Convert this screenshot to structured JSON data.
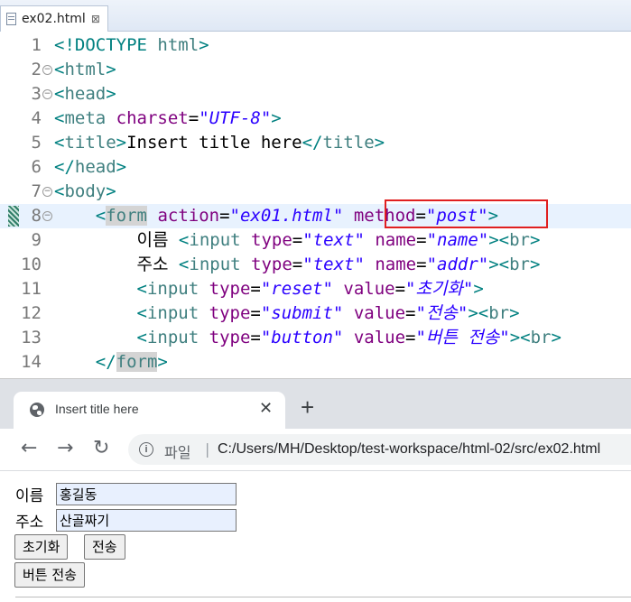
{
  "editor": {
    "tab_label": "ex02.html",
    "tab_close": "⊠",
    "lines": [
      {
        "n": "1",
        "fold": "",
        "tokens": [
          [
            "tg",
            "<!DOCTYPE "
          ],
          [
            "el",
            "html"
          ],
          [
            "tg",
            ">"
          ]
        ]
      },
      {
        "n": "2",
        "fold": "⊖",
        "tokens": [
          [
            "tg",
            "<"
          ],
          [
            "el",
            "html"
          ],
          [
            "tg",
            ">"
          ]
        ]
      },
      {
        "n": "3",
        "fold": "⊖",
        "tokens": [
          [
            "tg",
            "<"
          ],
          [
            "el",
            "head"
          ],
          [
            "tg",
            ">"
          ]
        ]
      },
      {
        "n": "4",
        "fold": "",
        "tokens": [
          [
            "tg",
            "<"
          ],
          [
            "el",
            "meta"
          ],
          [
            "tx",
            " "
          ],
          [
            "at",
            "charset"
          ],
          [
            "eq",
            "="
          ],
          [
            "av",
            "\"UTF-8\""
          ],
          [
            "tg",
            ">"
          ]
        ]
      },
      {
        "n": "5",
        "fold": "",
        "tokens": [
          [
            "tg",
            "<"
          ],
          [
            "el",
            "title"
          ],
          [
            "tg",
            ">"
          ],
          [
            "tx",
            "Insert title here"
          ],
          [
            "tg",
            "</"
          ],
          [
            "el",
            "title"
          ],
          [
            "tg",
            ">"
          ]
        ]
      },
      {
        "n": "6",
        "fold": "",
        "tokens": [
          [
            "tg",
            "</"
          ],
          [
            "el",
            "head"
          ],
          [
            "tg",
            ">"
          ]
        ]
      },
      {
        "n": "7",
        "fold": "⊖",
        "tokens": [
          [
            "tg",
            "<"
          ],
          [
            "el",
            "body"
          ],
          [
            "tg",
            ">"
          ]
        ]
      },
      {
        "n": "8",
        "fold": "⊖",
        "current": true,
        "marker": true,
        "tokens": [
          [
            "tx",
            "    "
          ],
          [
            "tg",
            "<"
          ],
          [
            "hl",
            "form"
          ],
          [
            "tx",
            " "
          ],
          [
            "at",
            "action"
          ],
          [
            "eq",
            "="
          ],
          [
            "av",
            "\"ex01.html\""
          ],
          [
            "tx",
            " "
          ],
          [
            "at",
            "method"
          ],
          [
            "eq",
            "="
          ],
          [
            "av",
            "\"post\""
          ],
          [
            "tg",
            ">"
          ]
        ]
      },
      {
        "n": "9",
        "fold": "",
        "tokens": [
          [
            "tx",
            "        이름 "
          ],
          [
            "tg",
            "<"
          ],
          [
            "el",
            "input"
          ],
          [
            "tx",
            " "
          ],
          [
            "at",
            "type"
          ],
          [
            "eq",
            "="
          ],
          [
            "av",
            "\"text\""
          ],
          [
            "tx",
            " "
          ],
          [
            "at",
            "name"
          ],
          [
            "eq",
            "="
          ],
          [
            "av",
            "\"name\""
          ],
          [
            "tg",
            "><"
          ],
          [
            "el",
            "br"
          ],
          [
            "tg",
            ">"
          ]
        ]
      },
      {
        "n": "10",
        "fold": "",
        "tokens": [
          [
            "tx",
            "        주소 "
          ],
          [
            "tg",
            "<"
          ],
          [
            "el",
            "input"
          ],
          [
            "tx",
            " "
          ],
          [
            "at",
            "type"
          ],
          [
            "eq",
            "="
          ],
          [
            "av",
            "\"text\""
          ],
          [
            "tx",
            " "
          ],
          [
            "at",
            "name"
          ],
          [
            "eq",
            "="
          ],
          [
            "av",
            "\"addr\""
          ],
          [
            "tg",
            "><"
          ],
          [
            "el",
            "br"
          ],
          [
            "tg",
            ">"
          ]
        ]
      },
      {
        "n": "11",
        "fold": "",
        "tokens": [
          [
            "tx",
            "        "
          ],
          [
            "tg",
            "<"
          ],
          [
            "el",
            "input"
          ],
          [
            "tx",
            " "
          ],
          [
            "at",
            "type"
          ],
          [
            "eq",
            "="
          ],
          [
            "av",
            "\"reset\""
          ],
          [
            "tx",
            " "
          ],
          [
            "at",
            "value"
          ],
          [
            "eq",
            "="
          ],
          [
            "av",
            "\"초기화\""
          ],
          [
            "tg",
            ">"
          ]
        ]
      },
      {
        "n": "12",
        "fold": "",
        "tokens": [
          [
            "tx",
            "        "
          ],
          [
            "tg",
            "<"
          ],
          [
            "el",
            "input"
          ],
          [
            "tx",
            " "
          ],
          [
            "at",
            "type"
          ],
          [
            "eq",
            "="
          ],
          [
            "av",
            "\"submit\""
          ],
          [
            "tx",
            " "
          ],
          [
            "at",
            "value"
          ],
          [
            "eq",
            "="
          ],
          [
            "av",
            "\"전송\""
          ],
          [
            "tg",
            "><"
          ],
          [
            "el",
            "br"
          ],
          [
            "tg",
            ">"
          ]
        ]
      },
      {
        "n": "13",
        "fold": "",
        "tokens": [
          [
            "tx",
            "        "
          ],
          [
            "tg",
            "<"
          ],
          [
            "el",
            "input"
          ],
          [
            "tx",
            " "
          ],
          [
            "at",
            "type"
          ],
          [
            "eq",
            "="
          ],
          [
            "av",
            "\"button\""
          ],
          [
            "tx",
            " "
          ],
          [
            "at",
            "value"
          ],
          [
            "eq",
            "="
          ],
          [
            "av",
            "\"버튼 전송\""
          ],
          [
            "tg",
            "><"
          ],
          [
            "el",
            "br"
          ],
          [
            "tg",
            ">"
          ]
        ]
      },
      {
        "n": "14",
        "fold": "",
        "tokens": [
          [
            "tx",
            "    "
          ],
          [
            "tg",
            "</"
          ],
          [
            "hl",
            "form"
          ],
          [
            "tg",
            ">"
          ]
        ]
      }
    ]
  },
  "browser": {
    "tab_title": "Insert title here",
    "tab_close": "✕",
    "new_tab": "+",
    "back": "←",
    "forward": "→",
    "reload": "↻",
    "info": "i",
    "scheme_label": "파일",
    "separator": "|",
    "url": "C:/Users/MH/Desktop/test-workspace/html-02/src/ex02.html"
  },
  "form": {
    "name_label": "이름",
    "name_value": "홍길동",
    "addr_label": "주소",
    "addr_value": "산골짜기",
    "reset_label": "초기화",
    "submit_label": "전송",
    "button_label": "버튼 전송"
  },
  "colors": {
    "tag": "#008080",
    "attribute": "#7f007f",
    "attr_value": "#2a00ff",
    "highlight_box": "#e02020",
    "autofill_bg": "#e8f0fe"
  }
}
